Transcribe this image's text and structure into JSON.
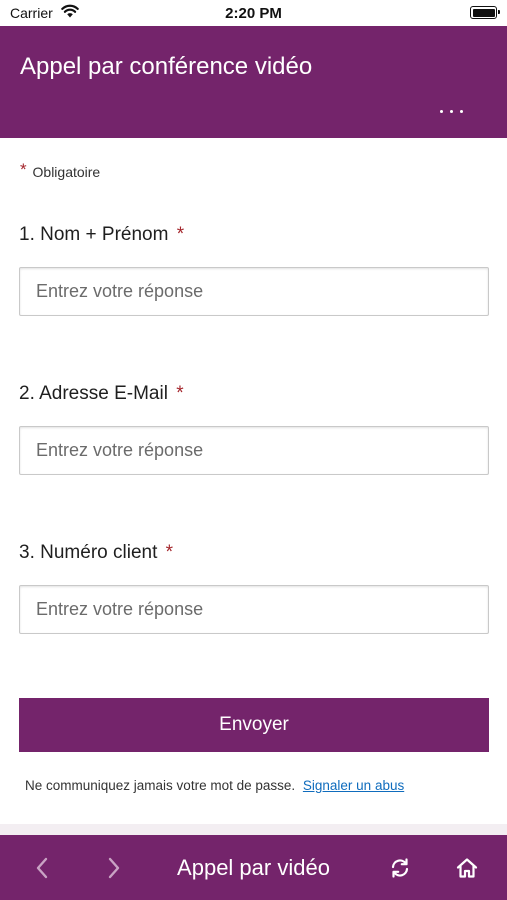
{
  "status_bar": {
    "carrier": "Carrier",
    "time": "2:20 PM"
  },
  "header": {
    "title": "Appel par conférence vidéo",
    "more_icon": "more-horizontal-icon"
  },
  "form": {
    "required_star": "*",
    "required_label": "Obligatoire",
    "questions": [
      {
        "number": "1.",
        "label": "Nom + Prénom",
        "star": "*",
        "placeholder": "Entrez votre réponse"
      },
      {
        "number": "2.",
        "label": "Adresse E-Mail",
        "star": "*",
        "placeholder": "Entrez votre réponse"
      },
      {
        "number": "3.",
        "label": "Numéro client",
        "star": "*",
        "placeholder": "Entrez votre réponse"
      }
    ],
    "submit_label": "Envoyer",
    "footer_text": "Ne communiquez jamais votre mot de passe.",
    "report_link": "Signaler un abus"
  },
  "bottom_bar": {
    "title": "Appel par vidéo",
    "icons": [
      "chevron-left-icon",
      "chevron-right-icon",
      "refresh-icon",
      "home-icon"
    ]
  },
  "colors": {
    "brand": "#74246b",
    "required": "#a4262c",
    "link": "#0f6cbd"
  }
}
